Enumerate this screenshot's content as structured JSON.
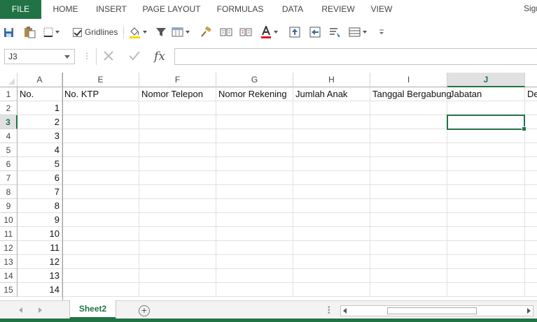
{
  "ribbon": {
    "file_tab": "FILE",
    "tabs": [
      "HOME",
      "INSERT",
      "PAGE LAYOUT",
      "FORMULAS",
      "DATA",
      "REVIEW",
      "VIEW"
    ],
    "signin": "Sign"
  },
  "toolbar": {
    "gridlines_label": "Gridlines",
    "gridlines_checked": true,
    "font_color": "#e81123",
    "fill_color": "#ffd400"
  },
  "formula_bar": {
    "name_box": "J3",
    "fx_label": "fx",
    "formula": ""
  },
  "sheet": {
    "columns": [
      "A",
      "E",
      "F",
      "G",
      "H",
      "I",
      "J",
      ""
    ],
    "active_column": "J",
    "rows": [
      "1",
      "2",
      "3",
      "4",
      "5",
      "6",
      "7",
      "8",
      "9",
      "10",
      "11",
      "12",
      "13",
      "14",
      "15"
    ],
    "active_row": "3",
    "headers": [
      "No.",
      "No. KTP",
      "Nomor Telepon",
      "Nomor Rekening",
      "Jumlah Anak",
      "Tanggal Bergabung",
      "Jabatan",
      "De"
    ],
    "numbers": [
      "1",
      "2",
      "3",
      "4",
      "5",
      "6",
      "7",
      "8",
      "9",
      "10",
      "11",
      "12",
      "13",
      "14"
    ],
    "selected_cell": "J3"
  },
  "sheet_tabs": {
    "active": "Sheet2",
    "add_label": "+"
  },
  "colors": {
    "accent": "#217346",
    "grid_line": "#e1e1e1",
    "header_bg": "#e1e1e1"
  }
}
